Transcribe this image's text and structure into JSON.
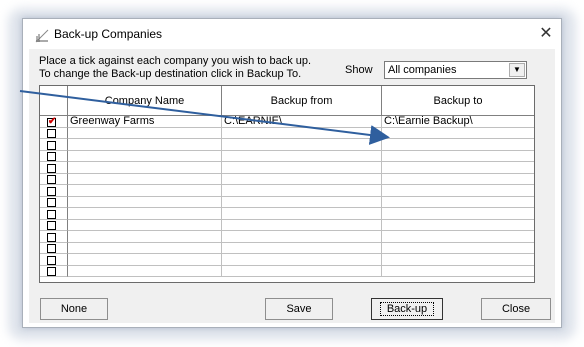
{
  "window": {
    "title": "Back-up Companies",
    "close_glyph": "✕"
  },
  "instructions": {
    "line1": "Place a tick against each company you wish to back up.",
    "line2": "To change the Back-up destination click in Backup To."
  },
  "filter": {
    "label": "Show",
    "value": "All companies"
  },
  "table": {
    "columns": [
      "Company Name",
      "Backup from",
      "Backup to"
    ],
    "rows": [
      {
        "checked": true,
        "name": "Greenway Farms",
        "from": "C:\\EARNIE\\",
        "to": "C:\\Earnie Backup\\"
      },
      {
        "checked": false,
        "name": "",
        "from": "",
        "to": ""
      },
      {
        "checked": false,
        "name": "",
        "from": "",
        "to": ""
      },
      {
        "checked": false,
        "name": "",
        "from": "",
        "to": ""
      },
      {
        "checked": false,
        "name": "",
        "from": "",
        "to": ""
      },
      {
        "checked": false,
        "name": "",
        "from": "",
        "to": ""
      },
      {
        "checked": false,
        "name": "",
        "from": "",
        "to": ""
      },
      {
        "checked": false,
        "name": "",
        "from": "",
        "to": ""
      },
      {
        "checked": false,
        "name": "",
        "from": "",
        "to": ""
      },
      {
        "checked": false,
        "name": "",
        "from": "",
        "to": ""
      },
      {
        "checked": false,
        "name": "",
        "from": "",
        "to": ""
      },
      {
        "checked": false,
        "name": "",
        "from": "",
        "to": ""
      },
      {
        "checked": false,
        "name": "",
        "from": "",
        "to": ""
      },
      {
        "checked": false,
        "name": "",
        "from": "",
        "to": ""
      }
    ]
  },
  "buttons": {
    "none": "None",
    "save": "Save",
    "backup": "Back-up",
    "close": "Close"
  },
  "colors": {
    "arrow": "#2f5f9e",
    "check": "#d00000"
  }
}
